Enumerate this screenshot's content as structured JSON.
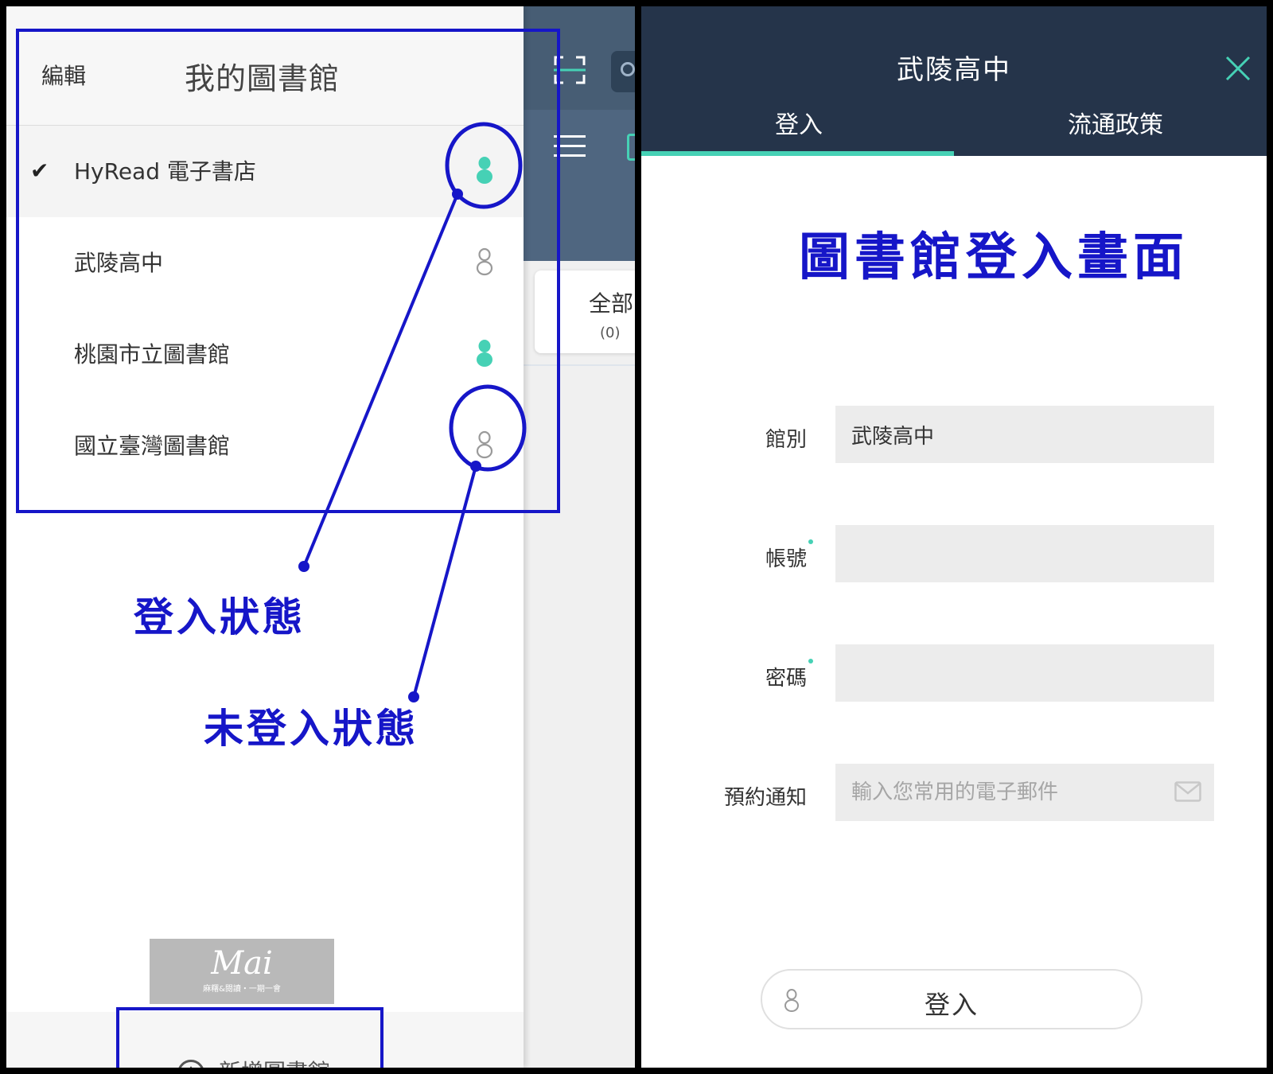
{
  "left_panel": {
    "drawer": {
      "edit_label": "編輯",
      "title": "我的圖書館",
      "libraries": [
        {
          "name": "HyRead 電子書店",
          "selected": true,
          "logged_in": true
        },
        {
          "name": "武陵高中",
          "selected": false,
          "logged_in": false
        },
        {
          "name": "桃園市立圖書館",
          "selected": false,
          "logged_in": true
        },
        {
          "name": "國立臺灣圖書館",
          "selected": false,
          "logged_in": false
        }
      ],
      "checkmark": "✔",
      "add_library_label": "新增圖書館"
    },
    "background_app": {
      "card_label": "全部",
      "card_count": "(0)"
    },
    "annotations": {
      "logged_in_label": "登入狀態",
      "not_logged_in_label": "未登入狀態",
      "color": "#1616c8"
    },
    "watermark": {
      "logo": "Mai",
      "subtitle": "麻糬&閱讀・一期一會"
    }
  },
  "right_panel": {
    "header": {
      "title": "武陵高中",
      "tabs": [
        {
          "label": "登入",
          "active": true
        },
        {
          "label": "流通政策",
          "active": false
        }
      ]
    },
    "screen_title": "圖書館登入畫面",
    "form": {
      "library_label": "館別",
      "library_value": "武陵高中",
      "account_label": "帳號",
      "account_value": "",
      "password_label": "密碼",
      "password_value": "",
      "notify_label": "預約通知",
      "notify_placeholder": "輸入您常用的電子郵件"
    },
    "login_button_label": "登入"
  },
  "colors": {
    "header_bg": "#25344a",
    "accent_teal": "#46d1b5",
    "annotation_blue": "#1616c8",
    "field_bg": "#ececec"
  },
  "icons": {
    "status_logged_in": "person-filled-icon",
    "status_logged_out": "person-outline-icon",
    "close": "close-icon",
    "mail": "mail-icon",
    "scan": "scan-icon",
    "menu": "menu-icon",
    "search": "search-icon",
    "add": "plus-circle-icon"
  }
}
